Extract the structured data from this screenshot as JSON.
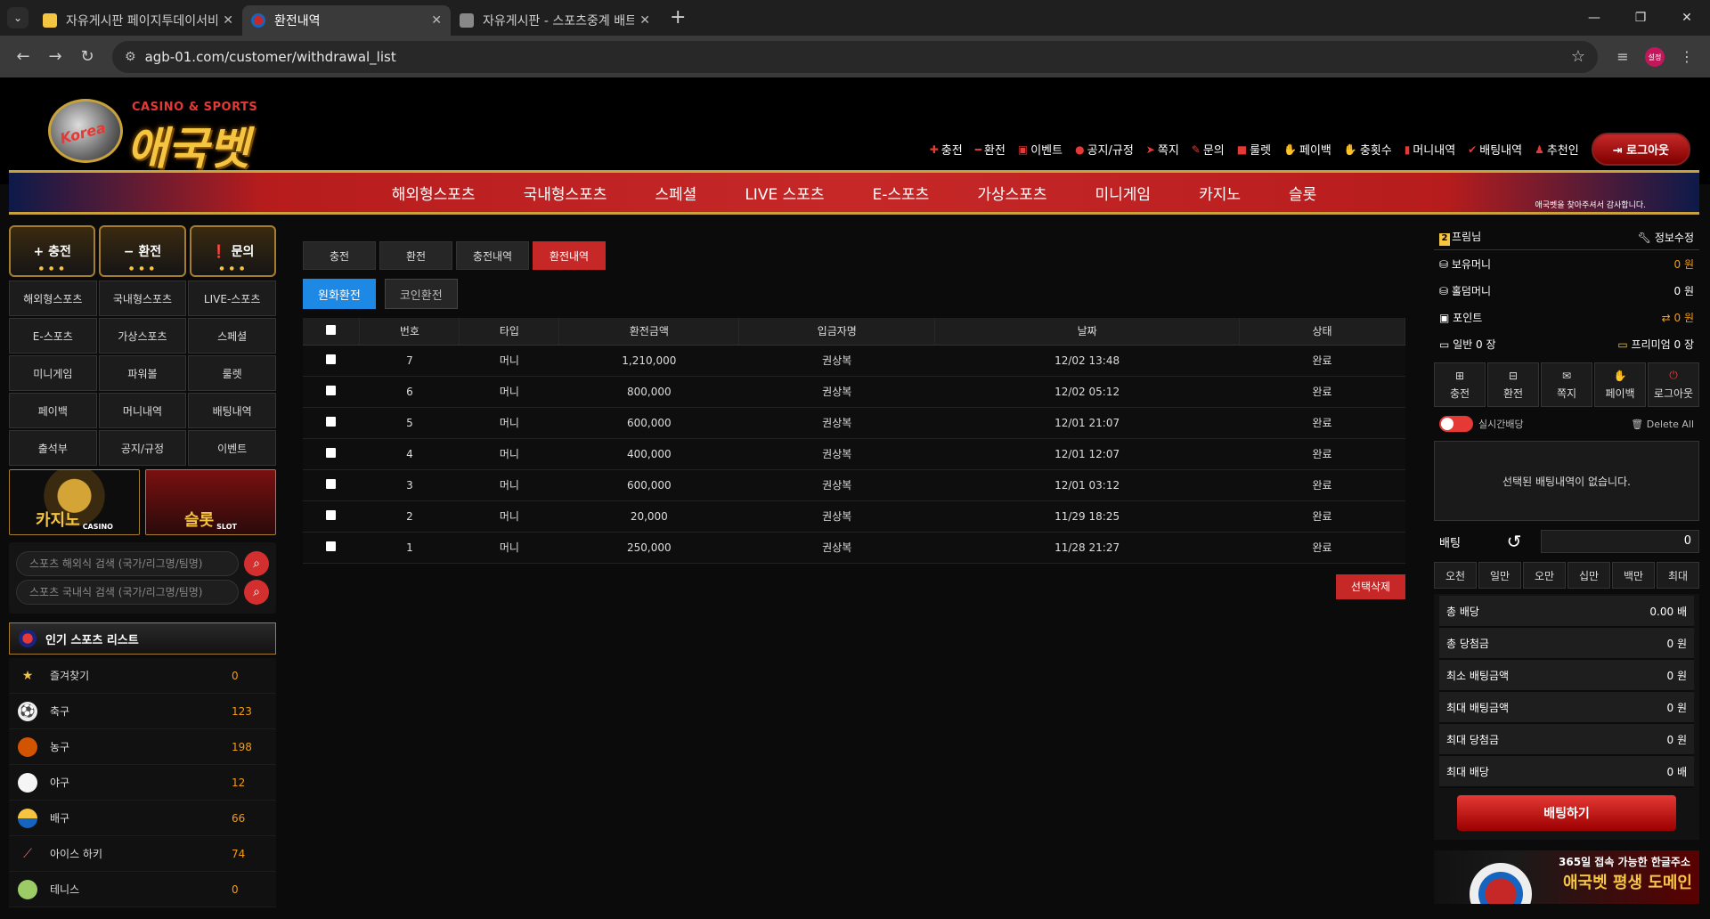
{
  "browser": {
    "tabs": [
      {
        "title": "자유게시판 페이지투데이서비",
        "active": false
      },
      {
        "title": "환전내역",
        "active": true
      },
      {
        "title": "자유게시판 - 스포츠중계 배트맨",
        "active": false
      }
    ],
    "url": "agb-01.com/customer/withdrawal_list",
    "profile_label": "설정"
  },
  "logo": {
    "sub": "CASINO & SPORTS",
    "main": "애국벳",
    "badge": "Korea"
  },
  "topmenu": [
    {
      "icon": "plus-icon",
      "label": "충전"
    },
    {
      "icon": "minus-icon",
      "label": "환전"
    },
    {
      "icon": "calendar-icon",
      "label": "이벤트"
    },
    {
      "icon": "alert-icon",
      "label": "공지/규정"
    },
    {
      "icon": "paper-plane-icon",
      "label": "쪽지"
    },
    {
      "icon": "edit-icon",
      "label": "문의"
    },
    {
      "icon": "gift-icon",
      "label": "룰렛"
    },
    {
      "icon": "hand-icon",
      "label": "페이백"
    },
    {
      "icon": "hand-icon",
      "label": "충횟수"
    },
    {
      "icon": "trash-icon",
      "label": "머니내역"
    },
    {
      "icon": "check-icon",
      "label": "배팅내역"
    },
    {
      "icon": "users-icon",
      "label": "추천인"
    }
  ],
  "logout_label": "로그아웃",
  "mainnav": [
    "해외형스포츠",
    "국내형스포츠",
    "스페셜",
    "LIVE 스포츠",
    "E-스포츠",
    "가상스포츠",
    "미니게임",
    "카지노",
    "슬롯"
  ],
  "nav_thanks": "애국벳을 찾아주셔서 감사합니다.",
  "left": {
    "quick": [
      "+ 충전",
      "− 환전",
      "❗ 문의"
    ],
    "grid": [
      "해외형스포츠",
      "국내형스포츠",
      "LIVE-스포츠",
      "E-스포츠",
      "가상스포츠",
      "스페셜",
      "미니게임",
      "파워볼",
      "룰렛",
      "페이백",
      "머니내역",
      "배팅내역",
      "출석부",
      "공지/규정",
      "이벤트"
    ],
    "banners": [
      {
        "label": "카지노",
        "sub": "CASINO"
      },
      {
        "label": "슬롯",
        "sub": "SLOT"
      }
    ],
    "search": [
      "스포츠 해외식 검색 (국가/리그명/팀명)",
      "스포츠 국내식 검색 (국가/리그명/팀명)"
    ],
    "popular_title": "인기 스포츠 리스트",
    "sports": [
      {
        "name": "즐겨찾기",
        "count": "0",
        "icon": "star-icon"
      },
      {
        "name": "축구",
        "count": "123",
        "icon": "soccer-icon"
      },
      {
        "name": "농구",
        "count": "198",
        "icon": "basketball-icon"
      },
      {
        "name": "야구",
        "count": "12",
        "icon": "baseball-icon"
      },
      {
        "name": "배구",
        "count": "66",
        "icon": "volleyball-icon"
      },
      {
        "name": "아이스 하키",
        "count": "74",
        "icon": "hockey-icon"
      },
      {
        "name": "테니스",
        "count": "0",
        "icon": "tennis-icon"
      }
    ]
  },
  "center": {
    "tabs": [
      "충전",
      "환전",
      "충전내역",
      "환전내역"
    ],
    "subtabs": [
      "원화환전",
      "코인환전"
    ],
    "columns": [
      "번호",
      "타입",
      "환전금액",
      "입금자명",
      "날짜",
      "상태"
    ],
    "rows": [
      [
        "7",
        "머니",
        "1,210,000",
        "권상복",
        "12/02 13:48",
        "완료"
      ],
      [
        "6",
        "머니",
        "800,000",
        "권상복",
        "12/02 05:12",
        "완료"
      ],
      [
        "5",
        "머니",
        "600,000",
        "권상복",
        "12/01 21:07",
        "완료"
      ],
      [
        "4",
        "머니",
        "400,000",
        "권상복",
        "12/01 12:07",
        "완료"
      ],
      [
        "3",
        "머니",
        "600,000",
        "권상복",
        "12/01 03:12",
        "완료"
      ],
      [
        "2",
        "머니",
        "20,000",
        "권상복",
        "11/29 18:25",
        "완료"
      ],
      [
        "1",
        "머니",
        "250,000",
        "권상복",
        "11/28 21:27",
        "완료"
      ]
    ],
    "delete_label": "선택삭제"
  },
  "right": {
    "user": "프림님",
    "edit_label": "정보수정",
    "rows": [
      {
        "label": "보유머니",
        "value": "0 원",
        "value_class": "o"
      },
      {
        "label": "홀덤머니",
        "value": "0 원",
        "value_class": "v"
      },
      {
        "label": "포인트",
        "value": "⇄ 0 원",
        "value_class": "o"
      },
      {
        "label": "일반 0 장",
        "value": "프리미엄 0 장",
        "value_class": "v"
      }
    ],
    "actions": [
      "충전",
      "환전",
      "쪽지",
      "페이백",
      "로그아웃"
    ],
    "toggle_label": "실시간배당",
    "delete_all": "Delete All",
    "betslip_empty": "선택된 배팅내역이 없습니다.",
    "bet_label": "배팅",
    "bet_value": "0",
    "amounts": [
      "오천",
      "일만",
      "오만",
      "십만",
      "백만",
      "최대"
    ],
    "summary": [
      {
        "label": "총 배당",
        "value": "0.00 배"
      },
      {
        "label": "총 당첨금",
        "value": "0 원"
      },
      {
        "label": "최소 배팅금액",
        "value": "0 원"
      },
      {
        "label": "최대 배팅금액",
        "value": "0 원"
      },
      {
        "label": "최대 당첨금",
        "value": "0 원"
      },
      {
        "label": "최대 배당",
        "value": "0 배"
      }
    ],
    "bet_button": "배팅하기",
    "ad": {
      "line1": "365일 접속 가능한 한글주소",
      "line2": "애국벳 평생 도메인"
    }
  }
}
